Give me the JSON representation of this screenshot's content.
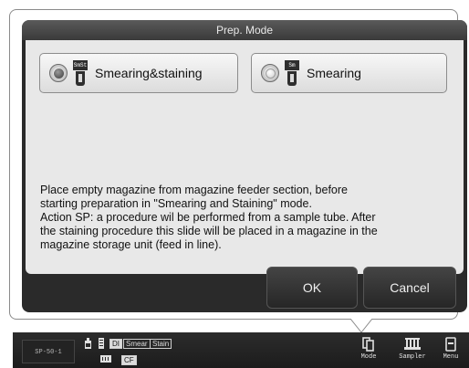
{
  "dialog": {
    "title": "Prep. Mode",
    "modes": [
      {
        "label": "Smearing&staining",
        "tube_code": "SmSt",
        "selected": true
      },
      {
        "label": "Smearing",
        "tube_code": "Sm",
        "selected": false
      }
    ],
    "description": [
      "Place empty magazine from magazine feeder section, before",
      "starting preparation in \"Smearing and Staining\" mode.",
      "Action SP: a procedure wil be performed from a sample tube.  After",
      "the staining procedure this slide will be placed in a magazine in the",
      "magazine storage unit (feed in line)."
    ],
    "ok_label": "OK",
    "cancel_label": "Cancel"
  },
  "statusbar": {
    "id": "SP-50-1",
    "tags": [
      "DI",
      "Smear",
      "Stain",
      "CF"
    ],
    "buttons": [
      {
        "label": "Mode",
        "icon": "mode-icon"
      },
      {
        "label": "Sampler",
        "icon": "sampler-icon"
      },
      {
        "label": "Menu",
        "icon": "menu-icon"
      }
    ]
  },
  "colors": {
    "dialog_bg": "#2a2a2a",
    "body_bg": "#e8e8e8",
    "statusbar_bg": "#1c1c1c"
  }
}
